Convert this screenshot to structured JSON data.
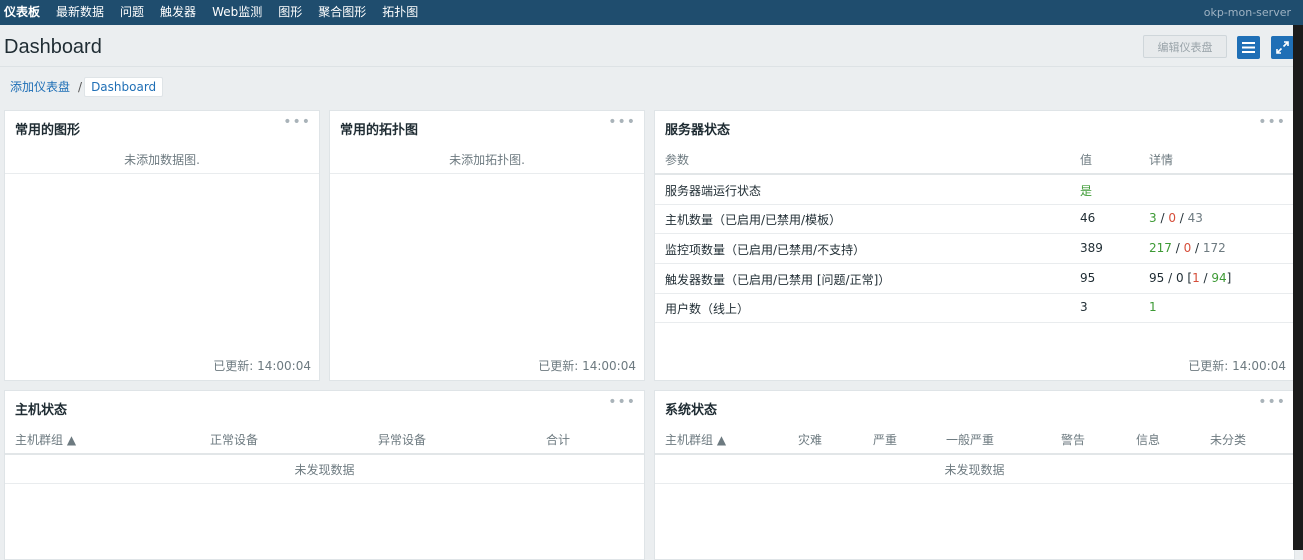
{
  "nav": {
    "items": [
      "仪表板",
      "最新数据",
      "问题",
      "触发器",
      "Web监测",
      "图形",
      "聚合图形",
      "拓扑图"
    ],
    "server_label": "okp-mon-server"
  },
  "header": {
    "title": "Dashboard",
    "edit_button": "编辑仪表盘"
  },
  "breadcrumb": {
    "parent": "添加仪表盘",
    "separator": "/",
    "current": "Dashboard"
  },
  "widgets": {
    "graphs": {
      "title": "常用的图形",
      "empty": "未添加数据图.",
      "updated": "已更新: 14:00:04"
    },
    "maps": {
      "title": "常用的拓扑图",
      "empty": "未添加拓扑图.",
      "updated": "已更新: 14:00:04"
    },
    "server_status": {
      "title": "服务器状态",
      "columns": [
        "参数",
        "值",
        "详情"
      ],
      "rows": [
        {
          "param": "服务器端运行状态",
          "value": "是",
          "detail": []
        },
        {
          "param": "主机数量（已启用/已禁用/模板）",
          "value": "46",
          "detail": [
            "3",
            " / ",
            "0",
            " / ",
            "43"
          ]
        },
        {
          "param": "监控项数量（已启用/已禁用/不支持）",
          "value": "389",
          "detail": [
            "217",
            " / ",
            "0",
            " / ",
            "172"
          ]
        },
        {
          "param": "触发器数量（已启用/已禁用 [问题/正常]）",
          "value": "95",
          "detail": [
            "95 / 0 [",
            "1",
            " / ",
            "94",
            "]"
          ]
        },
        {
          "param": "用户数（线上）",
          "value": "3",
          "detail": [
            "1"
          ]
        }
      ],
      "updated": "已更新: 14:00:04"
    },
    "host_status": {
      "title": "主机状态",
      "columns": [
        "主机群组 ▲",
        "正常设备",
        "异常设备",
        "合计"
      ],
      "empty": "未发现数据"
    },
    "system_status": {
      "title": "系统状态",
      "columns": [
        "主机群组 ▲",
        "灾难",
        "严重",
        "一般严重",
        "警告",
        "信息",
        "未分类"
      ],
      "empty": "未发现数据"
    }
  },
  "colors": {
    "nav_bg": "#1f4d6e",
    "accent": "#1f6fb6",
    "ok_green": "#3d9a35",
    "problem_red": "#d64e3a"
  }
}
